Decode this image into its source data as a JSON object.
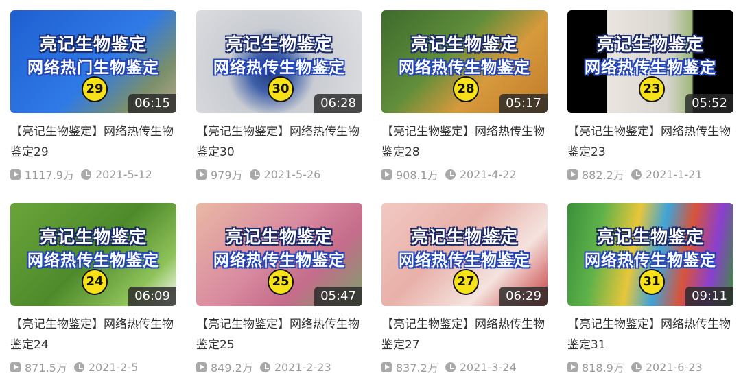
{
  "videos": [
    {
      "title": "【亮记生物鉴定】网络热传生物鉴定29",
      "cap1": "亮记生物鉴定",
      "cap2": "网络热门生物鉴定",
      "num": "29",
      "duration": "06:15",
      "views": "1117.9万",
      "date": "2021-5-12",
      "bg": "linear-gradient(135deg,#1f5fd1 0%,#2f7ae6 55%,#7a8f6a 80%,#b9a98b 100%)"
    },
    {
      "title": "【亮记生物鉴定】网络热传生物鉴定30",
      "cap1": "亮记生物鉴定",
      "cap2": "网络热传生物鉴定",
      "num": "30",
      "duration": "06:28",
      "views": "979万",
      "date": "2021-5-26",
      "bg": "radial-gradient(circle at 45% 60%,#233a80 0%,#3d5fa8 18%,#c9ccd2 40%,#dfe0e3 100%)"
    },
    {
      "title": "【亮记生物鉴定】网络热传生物鉴定28",
      "cap1": "亮记生物鉴定",
      "cap2": "网络热传生物鉴定",
      "num": "28",
      "duration": "05:17",
      "views": "908.1万",
      "date": "2021-4-22",
      "bg": "linear-gradient(135deg,#3f6b2e 0%,#5f8d3a 40%,#d79a3c 65%,#c07a2a 100%)"
    },
    {
      "title": "【亮记生物鉴定】网络热传生物鉴定23",
      "cap1": "亮记生物鉴定",
      "cap2": "网络热传生物鉴定",
      "num": "23",
      "duration": "05:52",
      "views": "882.2万",
      "date": "2021-1-21",
      "bg": "linear-gradient(90deg,#000 0%,#000 24%,#eae6df 24%,#d9d5cf 60%,#9fb97c 75%,#000 76%,#000 100%)"
    },
    {
      "title": "【亮记生物鉴定】网络热传生物鉴定24",
      "cap1": "亮记生物鉴定",
      "cap2": "网络热传生物鉴定",
      "num": "24",
      "duration": "06:09",
      "views": "871.5万",
      "date": "2021-2-5",
      "bg": "linear-gradient(135deg,#6aa53a 0%,#4e8a2b 50%,#8fc25a 80%,#ffffff 100%)"
    },
    {
      "title": "【亮记生物鉴定】网络热传生物鉴定25",
      "cap1": "亮记生物鉴定",
      "cap2": "网络热传生物鉴定",
      "num": "25",
      "duration": "05:47",
      "views": "849.2万",
      "date": "2021-2-23",
      "bg": "linear-gradient(135deg,#e9b8a4 0%,#d98aa0 45%,#c46c8a 70%,#7ba26a 100%)"
    },
    {
      "title": "【亮记生物鉴定】网络热传生物鉴定27",
      "cap1": "亮记生物鉴定",
      "cap2": "网络热传生物鉴定",
      "num": "27",
      "duration": "06:29",
      "views": "837.2万",
      "date": "2021-3-24",
      "bg": "linear-gradient(135deg,#f2c9c4 0%,#e8b0a8 40%,#f5e3df 70%,#c73a3a 100%)"
    },
    {
      "title": "【亮记生物鉴定】网络热传生物鉴定31",
      "cap1": "亮记生物鉴定",
      "cap2": "网络热传生物鉴定",
      "num": "31",
      "duration": "09:11",
      "views": "818.9万",
      "date": "2021-6-23",
      "bg": "linear-gradient(100deg,#3b8f3a 0%,#5fb24a 20%,#e8c63a 40%,#3fa3d8 55%,#d8543a 70%,#8a3fd0 85%,#3b8f3a 100%)"
    }
  ]
}
